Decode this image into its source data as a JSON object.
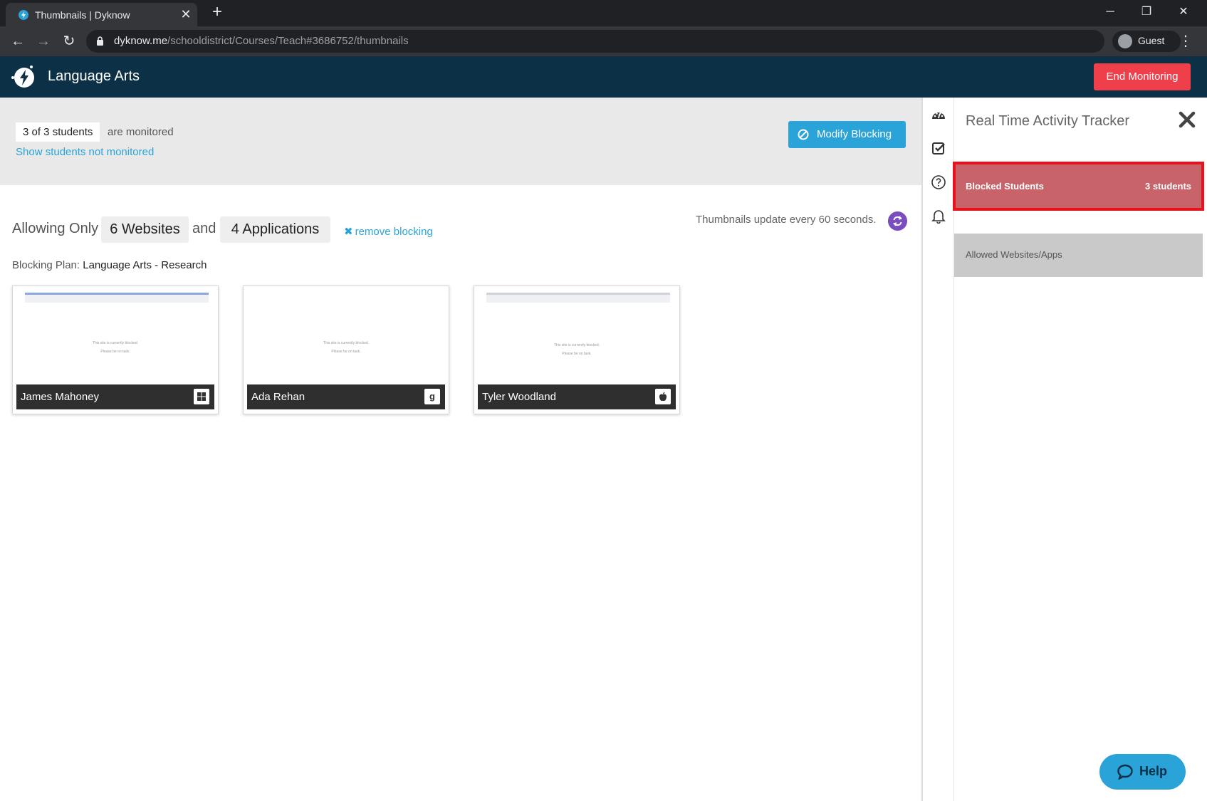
{
  "browser": {
    "tab_title": "Thumbnails | Dyknow",
    "url_host": "dyknow.me",
    "url_path": "/schooldistrict/Courses/Teach#3686752/thumbnails",
    "profile_name": "Guest"
  },
  "header": {
    "class_title": "Language Arts",
    "end_button": "End Monitoring"
  },
  "monitor": {
    "count": "3 of 3 students",
    "status": "are monitored",
    "show_link": "Show students not monitored",
    "modify_button": "Modify Blocking"
  },
  "blocking": {
    "allowing_label": "Allowing Only",
    "websites": "6 Websites",
    "and_label": "and",
    "applications": "4 Applications",
    "remove_link": "remove blocking",
    "update_text": "Thumbnails update every 60 seconds.",
    "plan_label": "Blocking Plan:",
    "plan_name": "Language Arts - Research"
  },
  "students": [
    {
      "name": "James Mahoney",
      "os_icon": "windows-icon",
      "screen_line1": "This site is currently blocked.",
      "screen_line2": "Please be on task."
    },
    {
      "name": "Ada Rehan",
      "os_icon": "google-icon",
      "screen_line1": "This site is currently blocked.",
      "screen_line2": "Please be on task."
    },
    {
      "name": "Tyler Woodland",
      "os_icon": "apple-icon",
      "screen_line1": "This site is currently blocked.",
      "screen_line2": "Please be on task."
    }
  ],
  "panel": {
    "title": "Real Time Activity Tracker",
    "blocked_label": "Blocked Students",
    "blocked_count": "3 students",
    "allowed_label": "Allowed Websites/Apps"
  },
  "help": {
    "label": "Help"
  },
  "colors": {
    "header_bg": "#0c3146",
    "accent_blue": "#2aa3d8",
    "end_red": "#ef3f4a",
    "blocked_row": "#c86469",
    "highlight_red": "#e8121c",
    "refresh_purple": "#7b4ec0"
  }
}
